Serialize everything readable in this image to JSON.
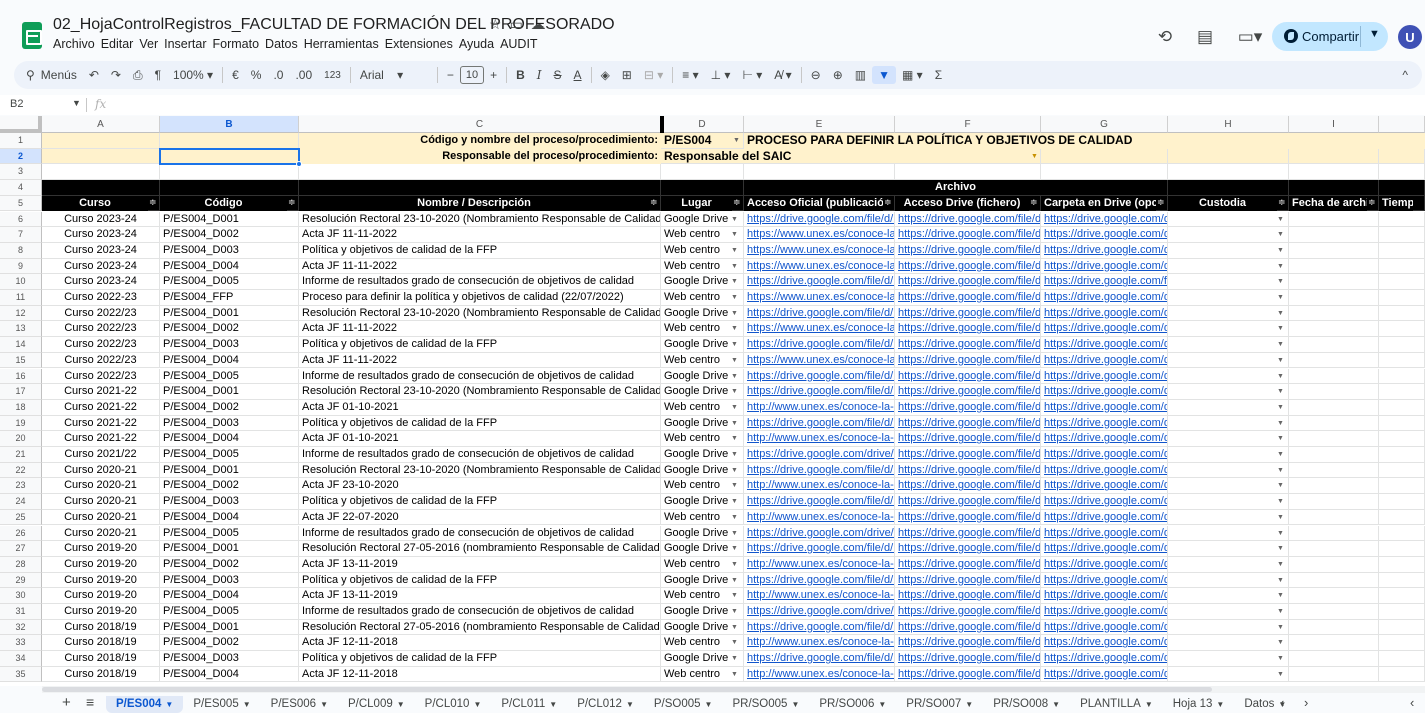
{
  "title": {
    "doc_name": "02_HojaControlRegistros_FACULTAD DE FORMACIÓN DEL PROFESORADO",
    "menu": [
      "Archivo",
      "Editar",
      "Ver",
      "Insertar",
      "Formato",
      "Datos",
      "Herramientas",
      "Extensiones",
      "Ayuda",
      "AUDIT"
    ]
  },
  "share": {
    "label": "Compartir",
    "avatar": "U"
  },
  "toolbar": {
    "menus_label": "Menús",
    "zoom": "100%",
    "currency": "€",
    "percent": "%",
    "dec_less": ".0",
    "dec_more": ".00",
    "number_format": "123",
    "font": "Arial",
    "font_size": "10",
    "bold": "B",
    "italic": "I",
    "strike": "S",
    "textcolor": "A",
    "sigma": "Σ"
  },
  "formula_bar": {
    "name_box": "B2",
    "fx": "fx",
    "content": ""
  },
  "columns": [
    "A",
    "B",
    "C",
    "D",
    "E",
    "F",
    "G",
    "H",
    "I"
  ],
  "header_rows": {
    "row1_label": "Código y nombre del proceso/procedimiento:",
    "row1_code": "P/ES004",
    "row1_name": "PROCESO PARA DEFINIR LA POLÍTICA Y OBJETIVOS DE CALIDAD",
    "row2_label": "Responsable del proceso/procedimiento:",
    "row2_value": "Responsable del SAIC",
    "row4_archivo": "Archivo",
    "row5": [
      "Curso",
      "Código",
      "Nombre / Descripción",
      "Lugar",
      "Acceso Oficial (publicación)",
      "Acceso Drive (fichero)",
      "Carpeta en Drive (opcional)",
      "Custodia",
      "Fecha de archivo",
      "Tiempo de"
    ]
  },
  "rows": [
    {
      "n": "6",
      "curso": "Curso 2023-24",
      "codigo": "P/ES004_D001",
      "nombre": "Resolución Rectoral 23-10-2020 (Nombramiento Responsable de Calidad)",
      "lugar": "Google Drive",
      "oficial": "https://drive.google.com/file/d/13F",
      "drive": "https://drive.google.com/file/d/1f(",
      "carpeta": "https://drive.google.com/driv"
    },
    {
      "n": "7",
      "curso": "Curso 2023-24",
      "codigo": "P/ES004_D002",
      "nombre": "Acta JF 11-11-2022",
      "lugar": "Web centro",
      "oficial": "https://www.unex.es/conoce-la-ue",
      "drive": "https://drive.google.com/file/d/1a",
      "carpeta": "https://drive.google.com/driv"
    },
    {
      "n": "8",
      "curso": "Curso 2023-24",
      "codigo": "P/ES004_D003",
      "nombre": "Política y objetivos de calidad de la FFP",
      "lugar": "Web centro",
      "oficial": "https://www.unex.es/conoce-la-ue",
      "drive": "https://drive.google.com/file/d/1C",
      "carpeta": "https://drive.google.com/driv"
    },
    {
      "n": "9",
      "curso": "Curso 2023-24",
      "codigo": "P/ES004_D004",
      "nombre": "Acta JF 11-11-2022",
      "lugar": "Web centro",
      "oficial": "https://www.unex.es/conoce-la-ue",
      "drive": "https://drive.google.com/file/d/1S",
      "carpeta": "https://drive.google.com/driv"
    },
    {
      "n": "10",
      "curso": "Curso 2023-24",
      "codigo": "P/ES004_D005",
      "nombre": "Informe de resultados grado de consecución de objetivos de calidad",
      "lugar": "Google Drive",
      "oficial": "https://drive.google.com/file/d/1qz",
      "drive": "https://drive.google.com/file/d/1q",
      "carpeta": "https://drive.google.com/file/"
    },
    {
      "n": "11",
      "curso": "Curso 2022-23",
      "codigo": "P/ES004_FFP",
      "nombre": "Proceso para definir la política y objetivos de calidad (22/07/2022)",
      "lugar": "Web centro",
      "oficial": "https://www.unex.es/conoce-la-ue",
      "drive": "https://drive.google.com/file/d/1L",
      "carpeta": "https://drive.google.com/driv"
    },
    {
      "n": "12",
      "curso": "Curso 2022/23",
      "codigo": "P/ES004_D001",
      "nombre": "Resolución Rectoral 23-10-2020 (Nombramiento Responsable de Calidad)",
      "lugar": "Google Drive",
      "oficial": "https://drive.google.com/file/d/13F",
      "drive": "https://drive.google.com/file/d/13",
      "carpeta": "https://drive.google.com/driv"
    },
    {
      "n": "13",
      "curso": "Curso 2022/23",
      "codigo": "P/ES004_D002",
      "nombre": "Acta JF 11-11-2022",
      "lugar": "Web centro",
      "oficial": "https://www.unex.es/conoce-la-ue",
      "drive": "https://drive.google.com/file/d/1ll",
      "carpeta": "https://drive.google.com/driv"
    },
    {
      "n": "14",
      "curso": "Curso 2022/23",
      "codigo": "P/ES004_D003",
      "nombre": "Política y objetivos de calidad de la FFP",
      "lugar": "Google Drive",
      "oficial": "https://drive.google.com/file/d/11-i",
      "drive": "https://drive.google.com/file/d/11",
      "carpeta": "https://drive.google.com/driv"
    },
    {
      "n": "15",
      "curso": "Curso 2022/23",
      "codigo": "P/ES004_D004",
      "nombre": "Acta JF 11-11-2022",
      "lugar": "Web centro",
      "oficial": "https://www.unex.es/conoce-la-ue",
      "drive": "https://drive.google.com/file/d/1P",
      "carpeta": "https://drive.google.com/driv"
    },
    {
      "n": "16",
      "curso": "Curso 2022/23",
      "codigo": "P/ES004_D005",
      "nombre": "Informe de resultados grado de consecución de objetivos de calidad",
      "lugar": "Google Drive",
      "oficial": "https://drive.google.com/file/d/1yu",
      "drive": "https://drive.google.com/file/d/1y",
      "carpeta": "https://drive.google.com/driv"
    },
    {
      "n": "17",
      "curso": "Curso 2021-22",
      "codigo": "P/ES004_D001",
      "nombre": "Resolución Rectoral 23-10-2020 (Nombramiento Responsable de Calidad)",
      "lugar": "Google Drive",
      "oficial": "https://drive.google.com/file/d/123",
      "drive": "https://drive.google.com/file/d/12",
      "carpeta": "https://drive.google.com/driv"
    },
    {
      "n": "18",
      "curso": "Curso 2021-22",
      "codigo": "P/ES004_D002",
      "nombre": "Acta JF 01-10-2021",
      "lugar": "Web centro",
      "oficial": "http://www.unex.es/conoce-la-uex",
      "drive": "https://drive.google.com/file/d/13",
      "carpeta": "https://drive.google.com/driv"
    },
    {
      "n": "19",
      "curso": "Curso 2021-22",
      "codigo": "P/ES004_D003",
      "nombre": "Política y objetivos de calidad de la FFP",
      "lugar": "Google Drive",
      "oficial": "https://drive.google.com/file/d/1Ky",
      "drive": "https://drive.google.com/file/d/1K",
      "carpeta": "https://drive.google.com/driv"
    },
    {
      "n": "20",
      "curso": "Curso 2021-22",
      "codigo": "P/ES004_D004",
      "nombre": "Acta JF 01-10-2021",
      "lugar": "Web centro",
      "oficial": "http://www.unex.es/conoce-la-uex",
      "drive": "https://drive.google.com/file/d/1J",
      "carpeta": "https://drive.google.com/driv"
    },
    {
      "n": "21",
      "curso": "Curso 2021/22",
      "codigo": "P/ES004_D005",
      "nombre": "Informe de resultados grado de consecución de objetivos de calidad",
      "lugar": "Google Drive",
      "oficial": "https://drive.google.com/drive/fold",
      "drive": "https://drive.google.com/file/d/1F",
      "carpeta": "https://drive.google.com/driv"
    },
    {
      "n": "22",
      "curso": "Curso 2020-21",
      "codigo": "P/ES004_D001",
      "nombre": "Resolución Rectoral 23-10-2020 (Nombramiento Responsable de Calidad)",
      "lugar": "Google Drive",
      "oficial": "https://drive.google.com/file/d/1Zy",
      "drive": "https://drive.google.com/file/d/1Z",
      "carpeta": "https://drive.google.com/driv"
    },
    {
      "n": "23",
      "curso": "Curso 2020-21",
      "codigo": "P/ES004_D002",
      "nombre": "Acta JF 23-10-2020",
      "lugar": "Web centro",
      "oficial": "http://www.unex.es/conoce-la-uex",
      "drive": "https://drive.google.com/file/d/1a",
      "carpeta": "https://drive.google.com/driv"
    },
    {
      "n": "24",
      "curso": "Curso 2020-21",
      "codigo": "P/ES004_D003",
      "nombre": "Política y objetivos de calidad de la FFP",
      "lugar": "Google Drive",
      "oficial": "https://drive.google.com/file/d/1G",
      "drive": "https://drive.google.com/file/d/1C",
      "carpeta": "https://drive.google.com/driv"
    },
    {
      "n": "25",
      "curso": "Curso 2020-21",
      "codigo": "P/ES004_D004",
      "nombre": "Acta JF 22-07-2020",
      "lugar": "Web centro",
      "oficial": "http://www.unex.es/conoce-la-uex",
      "drive": "https://drive.google.com/file/d/1a",
      "carpeta": "https://drive.google.com/driv"
    },
    {
      "n": "26",
      "curso": "Curso 2020-21",
      "codigo": "P/ES004_D005",
      "nombre": "Informe de resultados grado de consecución de objetivos de calidad",
      "lugar": "Google Drive",
      "oficial": "https://drive.google.com/drive/fold",
      "drive": "https://drive.google.com/file/d/1U",
      "carpeta": "https://drive.google.com/driv"
    },
    {
      "n": "27",
      "curso": "Curso 2019-20",
      "codigo": "P/ES004_D001",
      "nombre": "Resolución Rectoral 27-05-2016 (nombramiento Responsable de Calidad)",
      "lugar": "Google Drive",
      "oficial": "https://drive.google.com/file/d/1Dc",
      "drive": "https://drive.google.com/file/d/1D",
      "carpeta": "https://drive.google.com/driv"
    },
    {
      "n": "28",
      "curso": "Curso 2019-20",
      "codigo": "P/ES004_D002",
      "nombre": "Acta JF 13-11-2019",
      "lugar": "Web centro",
      "oficial": "http://www.unex.es/conoce-la-uex",
      "drive": "https://drive.google.com/file/d/17",
      "carpeta": "https://drive.google.com/driv"
    },
    {
      "n": "29",
      "curso": "Curso 2019-20",
      "codigo": "P/ES004_D003",
      "nombre": "Política y objetivos de calidad de la FFP",
      "lugar": "Google Drive",
      "oficial": "https://drive.google.com/file/d/1sf",
      "drive": "https://drive.google.com/file/d/1s",
      "carpeta": "https://drive.google.com/driv"
    },
    {
      "n": "30",
      "curso": "Curso 2019-20",
      "codigo": "P/ES004_D004",
      "nombre": "Acta JF 13-11-2019",
      "lugar": "Web centro",
      "oficial": "http://www.unex.es/conoce-la-uex",
      "drive": "https://drive.google.com/file/d/1u",
      "carpeta": "https://drive.google.com/driv"
    },
    {
      "n": "31",
      "curso": "Curso 2019-20",
      "codigo": "P/ES004_D005",
      "nombre": "Informe de resultados grado de consecución de objetivos de calidad",
      "lugar": "Google Drive",
      "oficial": "https://drive.google.com/drive/fold",
      "drive": "https://drive.google.com/file/d/1_",
      "carpeta": "https://drive.google.com/driv"
    },
    {
      "n": "32",
      "curso": "Curso 2018/19",
      "codigo": "P/ES004_D001",
      "nombre": "Resolución Rectoral 27-05-2016 (nombramiento Responsable de Calidad)",
      "lugar": "Google Drive",
      "oficial": "https://drive.google.com/file/d/1sj",
      "drive": "https://drive.google.com/file/d/1s",
      "carpeta": "https://drive.google.com/driv"
    },
    {
      "n": "33",
      "curso": "Curso 2018/19",
      "codigo": "P/ES004_D002",
      "nombre": "Acta JF 12-11-2018",
      "lugar": "Web centro",
      "oficial": "http://www.unex.es/conoce-la-uex",
      "drive": "https://drive.google.com/file/d/1A",
      "carpeta": "https://drive.google.com/driv"
    },
    {
      "n": "34",
      "curso": "Curso 2018/19",
      "codigo": "P/ES004_D003",
      "nombre": "Política y objetivos de calidad de la FFP",
      "lugar": "Google Drive",
      "oficial": "https://drive.google.com/file/d/1cz",
      "drive": "https://drive.google.com/file/d/1c",
      "carpeta": "https://drive.google.com/driv"
    },
    {
      "n": "35",
      "curso": "Curso 2018/19",
      "codigo": "P/ES004_D004",
      "nombre": "Acta JF 12-11-2018",
      "lugar": "Web centro",
      "oficial": "http://www.unex.es/conoce-la-uex",
      "drive": "https://drive.google.com/file/d/1z",
      "carpeta": "https://drive.google.com/driv"
    }
  ],
  "sheet_tabs": [
    "P/ES004",
    "P/ES005",
    "P/ES006",
    "P/CL009",
    "P/CL010",
    "P/CL011",
    "P/CL012",
    "P/SO005",
    "PR/SO005",
    "PR/SO006",
    "PR/SO007",
    "PR/SO008",
    "PLANTILLA",
    "Hoja 13",
    "Datos"
  ],
  "active_tab": "P/ES004",
  "colors": {
    "accent": "#0b57d0",
    "yellow": "#fff2cc",
    "link": "#1155cc",
    "share": "#c2e7ff"
  }
}
